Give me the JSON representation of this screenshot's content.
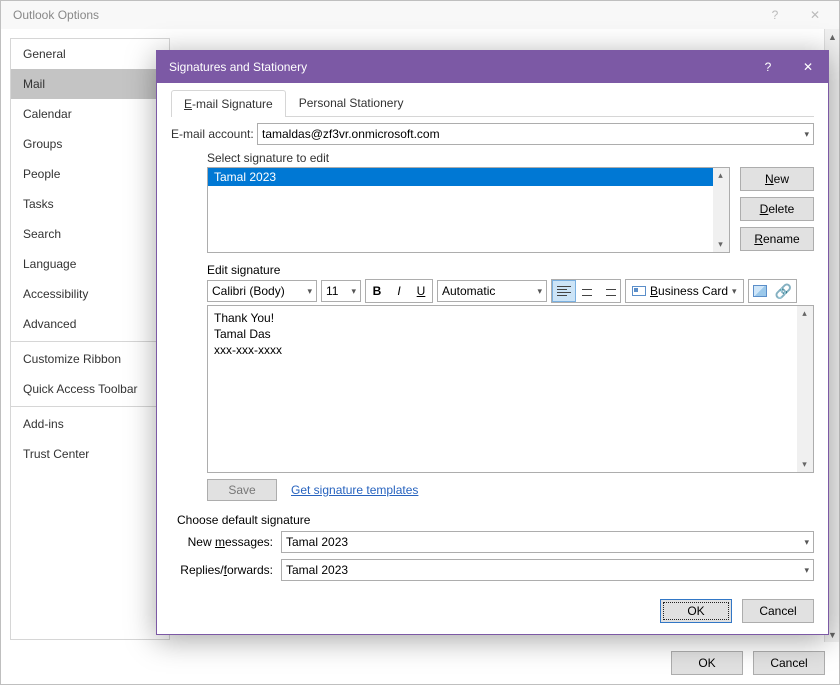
{
  "optWindow": {
    "title": "Outlook Options",
    "help": "?",
    "close": "✕",
    "footerOk": "OK",
    "footerCancel": "Cancel"
  },
  "sidebar": {
    "items": [
      "General",
      "Mail",
      "Calendar",
      "Groups",
      "People",
      "Tasks",
      "Search",
      "Language",
      "Accessibility",
      "Advanced"
    ],
    "items2": [
      "Customize Ribbon",
      "Quick Access Toolbar"
    ],
    "items3": [
      "Add-ins",
      "Trust Center"
    ],
    "selected": "Mail"
  },
  "modal": {
    "title": "Signatures and Stationery",
    "help": "?",
    "close": "✕",
    "tabs": {
      "email": "E-mail Signature",
      "stationery": "Personal Stationery",
      "emailUL": "E"
    },
    "accountLabel": "E-mail account:",
    "accountValue": "tamaldas@zf3vr.onmicrosoft.com",
    "selectTitle": "Select signature to edit",
    "sigItem": "Tamal 2023",
    "btnNew": "New",
    "btnDelete": "Delete",
    "btnRename": "Rename",
    "editTitle": "Edit signature",
    "font": "Calibri (Body)",
    "fontSize": "11",
    "bold": "B",
    "italic": "I",
    "underline": "U",
    "colorLabel": "Automatic",
    "bizCard": "Business Card",
    "sigLine1": "Thank You!",
    "sigLine2": "Tamal Das",
    "sigLine3": "xxx-xxx-xxxx",
    "save": "Save",
    "getTemplates": "Get signature templates",
    "chooseTitle": "Choose default signature",
    "newMsgLabel": "New messages:",
    "newMsgValue": "Tamal 2023",
    "replyLabel": "Replies/forwards:",
    "replyValue": "Tamal 2023",
    "ok": "OK",
    "cancel": "Cancel"
  }
}
